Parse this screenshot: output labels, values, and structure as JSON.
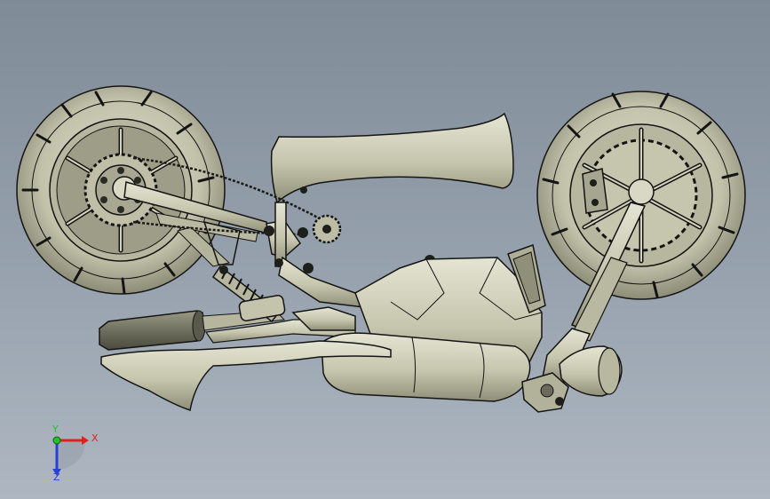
{
  "model": {
    "name": "motorcycle-assembly",
    "view": "underside"
  },
  "triad": {
    "x_label": "X",
    "y_label": "Y",
    "z_label": "Z",
    "x_color": "#e0211b",
    "y_color": "#22c22a",
    "z_color": "#2a3fd6"
  },
  "colors": {
    "background_top": "#808b98",
    "background_bottom": "#aeb7c1",
    "part_fill": "#c9c9b2",
    "part_shadow": "#8e8e78",
    "edge": "#141414"
  }
}
